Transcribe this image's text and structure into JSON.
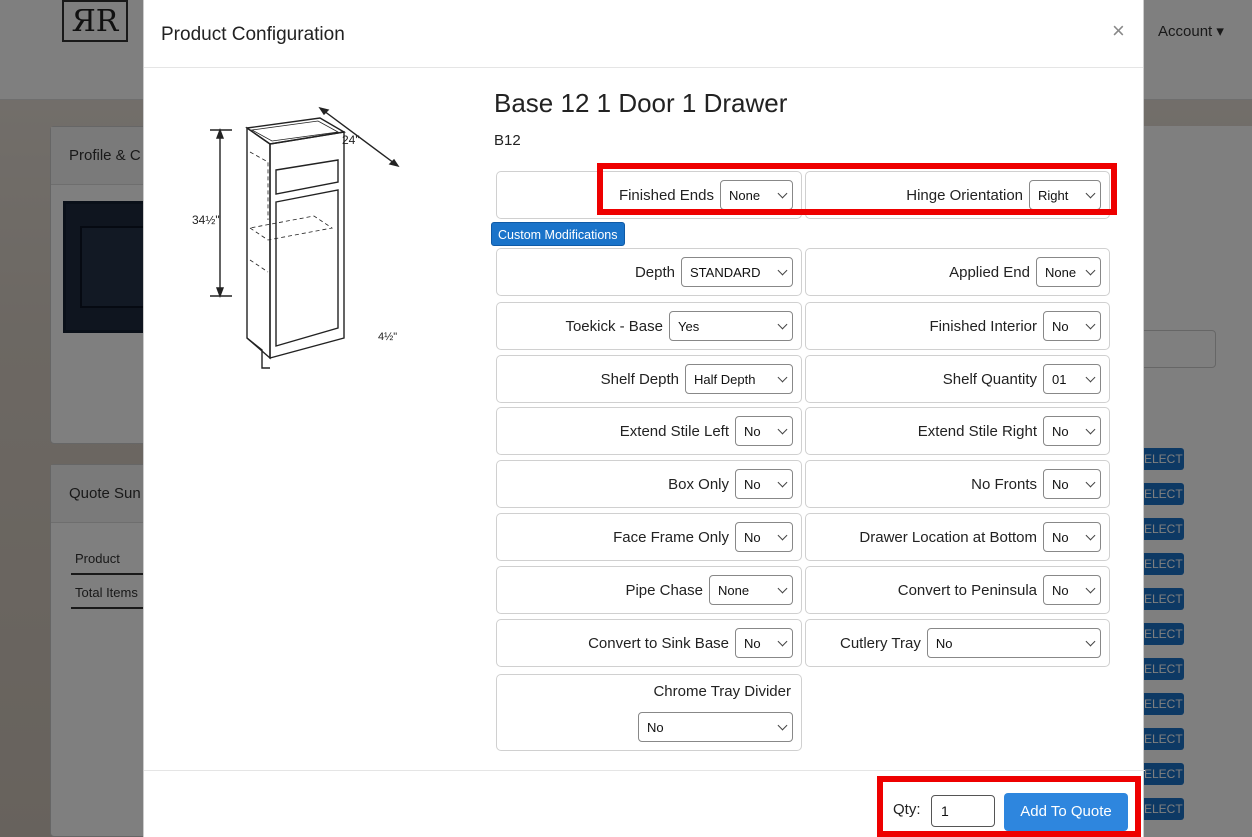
{
  "background": {
    "account_label": "Account ▾",
    "card1_title": "Profile & C",
    "card2_title": "Quote Sun",
    "table_rows": [
      "Product",
      "Total Items"
    ],
    "select_label": "ELECT"
  },
  "modal": {
    "title": "Product Configuration",
    "close_symbol": "×",
    "product": {
      "name": "Base 12 1 Door 1 Drawer",
      "code": "B12",
      "dims": {
        "width": "24\"",
        "height": "34½\"",
        "toekick": "4½\""
      }
    },
    "custom_mods_label": "Custom Modifications",
    "options": {
      "finished_ends": {
        "label": "Finished Ends",
        "value": "None"
      },
      "hinge_orientation": {
        "label": "Hinge Orientation",
        "value": "Right"
      },
      "depth": {
        "label": "Depth",
        "value": "STANDARD"
      },
      "applied_end": {
        "label": "Applied End",
        "value": "None"
      },
      "toekick_base": {
        "label": "Toekick - Base",
        "value": "Yes"
      },
      "finished_interior": {
        "label": "Finished Interior",
        "value": "No"
      },
      "shelf_depth": {
        "label": "Shelf Depth",
        "value": "Half Depth"
      },
      "shelf_quantity": {
        "label": "Shelf Quantity",
        "value": "01"
      },
      "extend_stile_left": {
        "label": "Extend Stile Left",
        "value": "No"
      },
      "extend_stile_right": {
        "label": "Extend Stile Right",
        "value": "No"
      },
      "box_only": {
        "label": "Box Only",
        "value": "No"
      },
      "no_fronts": {
        "label": "No Fronts",
        "value": "No"
      },
      "face_frame_only": {
        "label": "Face Frame Only",
        "value": "No"
      },
      "drawer_location_bottom": {
        "label": "Drawer Location at Bottom",
        "value": "No"
      },
      "pipe_chase": {
        "label": "Pipe Chase",
        "value": "None"
      },
      "convert_peninsula": {
        "label": "Convert to Peninsula",
        "value": "No"
      },
      "convert_sink_base": {
        "label": "Convert to Sink Base",
        "value": "No"
      },
      "cutlery_tray": {
        "label": "Cutlery Tray",
        "value": "No"
      },
      "chrome_tray_divider": {
        "label": "Chrome Tray Divider",
        "value": "No"
      }
    },
    "footer": {
      "qty_label": "Qty:",
      "qty_value": "1",
      "add_button": "Add To Quote"
    }
  }
}
